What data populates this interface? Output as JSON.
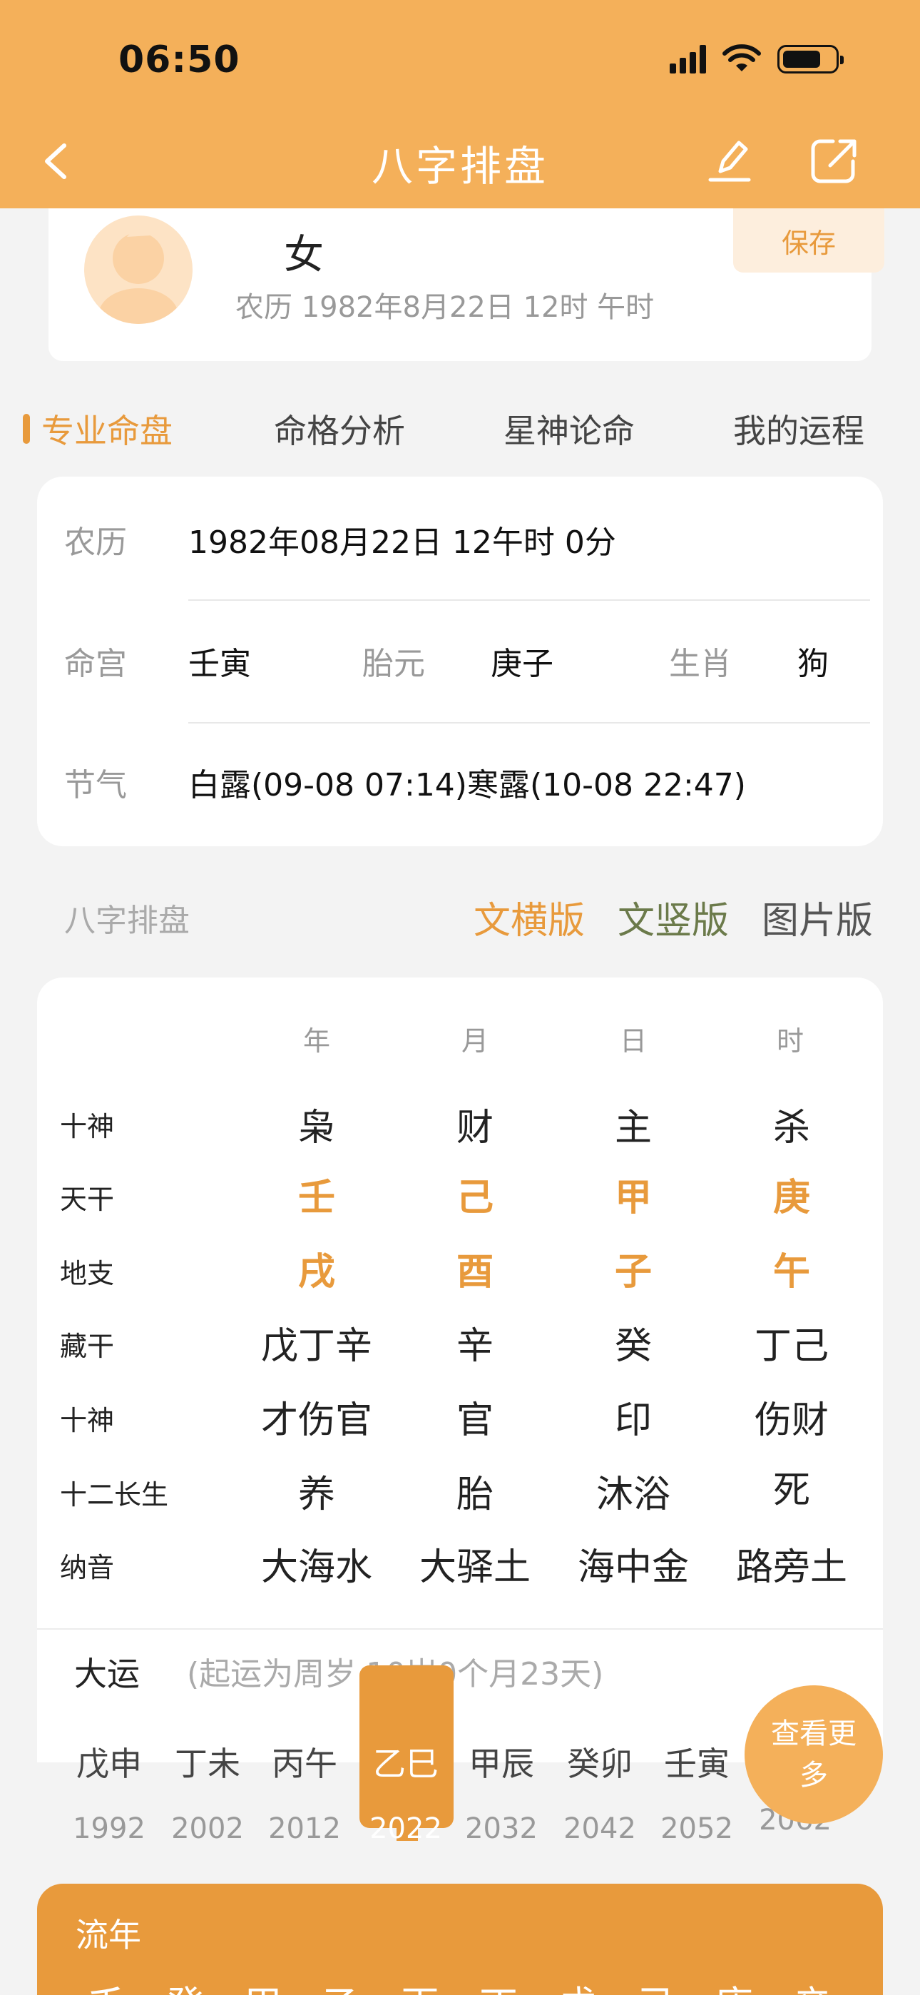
{
  "status_bar": {
    "time": "06:50"
  },
  "nav": {
    "title": "八字排盘",
    "back_icon": "chevron-left-icon",
    "edit_icon": "pencil-icon",
    "share_icon": "share-icon"
  },
  "profile": {
    "gender": "女",
    "lunar": "农历 1982年8月22日 12时 午时",
    "save_label": "保存"
  },
  "tabs": [
    {
      "label": "专业命盘",
      "active": true
    },
    {
      "label": "命格分析",
      "active": false
    },
    {
      "label": "星神论命",
      "active": false
    },
    {
      "label": "我的运程",
      "active": false
    }
  ],
  "info": {
    "lunar_label": "农历",
    "lunar_value": "1982年08月22日 12午时 0分",
    "minggong_label": "命宫",
    "minggong_value": "壬寅",
    "taiyuan_label": "胎元",
    "taiyuan_value": "庚子",
    "shengxiao_label": "生肖",
    "shengxiao_value": "狗",
    "jieqi_label": "节气",
    "jieqi_value": "白露(09-08 07:14)寒露(10-08 22:47)"
  },
  "section": {
    "title": "八字排盘",
    "versions": [
      "文横版",
      "文竖版",
      "图片版"
    ]
  },
  "chart": {
    "columns": [
      "年",
      "月",
      "日",
      "时"
    ],
    "rows": [
      {
        "label": "十神",
        "cells": [
          "枭",
          "财",
          "主",
          "杀"
        ],
        "highlight": false
      },
      {
        "label": "天干",
        "cells": [
          "壬",
          "己",
          "甲",
          "庚"
        ],
        "highlight": true
      },
      {
        "label": "地支",
        "cells": [
          "戌",
          "酉",
          "子",
          "午"
        ],
        "highlight": true
      },
      {
        "label": "藏干",
        "cells": [
          "戊丁辛",
          "辛",
          "癸",
          "丁己"
        ],
        "highlight": false
      },
      {
        "label": "十神",
        "cells": [
          "才伤官",
          "官",
          "印",
          "伤财"
        ],
        "highlight": false
      },
      {
        "label": "十二长生",
        "cells": [
          "养",
          "胎",
          "沐浴",
          "死"
        ],
        "highlight": false
      },
      {
        "label": "纳音",
        "cells": [
          "大海水",
          "大驿土",
          "海中金",
          "路旁土"
        ],
        "highlight": false
      }
    ]
  },
  "dayun": {
    "title": "大运",
    "subtitle": "(起运为周岁 10岁0个月23天)",
    "items": [
      {
        "gz": "戊申",
        "year": "1992"
      },
      {
        "gz": "丁未",
        "year": "2002"
      },
      {
        "gz": "丙午",
        "year": "2012"
      },
      {
        "gz": "乙巳",
        "year": "2022"
      },
      {
        "gz": "甲辰",
        "year": "2032"
      },
      {
        "gz": "癸卯",
        "year": "2042"
      },
      {
        "gz": "壬寅",
        "year": "2052"
      },
      {
        "gz": "",
        "year": "2062"
      }
    ],
    "active_index": 3,
    "more_label": "查看更多"
  },
  "liunian": {
    "title": "流年",
    "items": [
      "壬",
      "癸",
      "甲",
      "乙",
      "丙",
      "丁",
      "戊",
      "己",
      "庚",
      "辛"
    ]
  },
  "colors": {
    "header": "#f4b05a",
    "accent": "#e89a3c",
    "version_active": "#e89a3c",
    "version_mid": "#6b7a4a"
  }
}
